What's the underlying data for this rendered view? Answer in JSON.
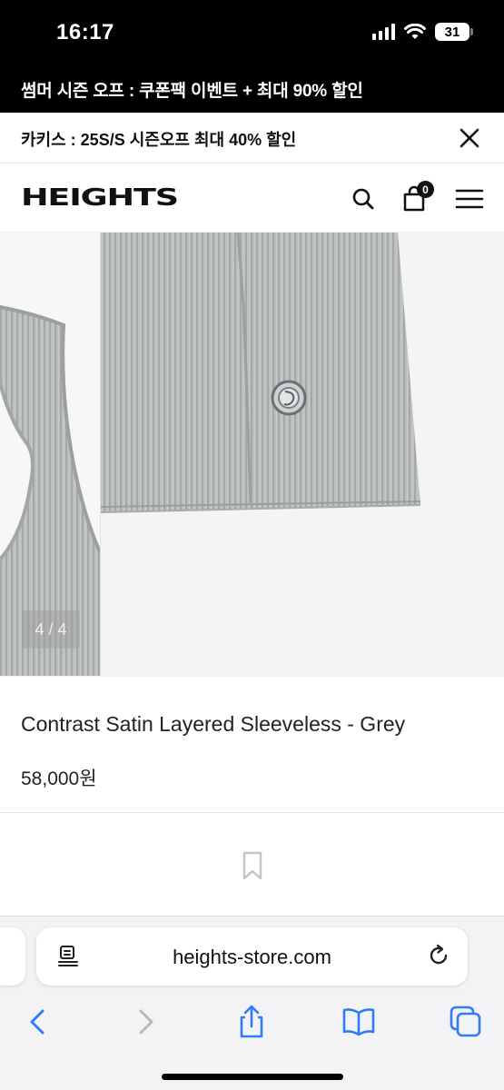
{
  "status_bar": {
    "time": "16:17",
    "battery": "31"
  },
  "promo_banner": {
    "text": "썸머 시즌 오프 : 쿠폰팩 이벤트 + 최대 90% 할인"
  },
  "notice": {
    "text": "카키스 : 25S/S 시즌오프 최대 40% 할인"
  },
  "header": {
    "logo": "HEIGHTS",
    "cart_count": "0"
  },
  "gallery": {
    "counter": "4 / 4"
  },
  "product": {
    "name": "Contrast Satin Layered Sleeveless - Grey",
    "price": "58,000원"
  },
  "browser": {
    "url": "heights-store.com"
  },
  "colors": {
    "fabric": "#b9bcbc",
    "black": "#000000",
    "accent_blue": "#2f7cf6"
  },
  "icons": [
    "signal-icon",
    "wifi-icon",
    "battery-icon",
    "close-icon",
    "search-icon",
    "cart-icon",
    "menu-icon",
    "bookmark-icon",
    "reader-icon",
    "reload-icon",
    "back-icon",
    "forward-icon",
    "share-icon",
    "bookmarks-icon",
    "tabs-icon"
  ]
}
